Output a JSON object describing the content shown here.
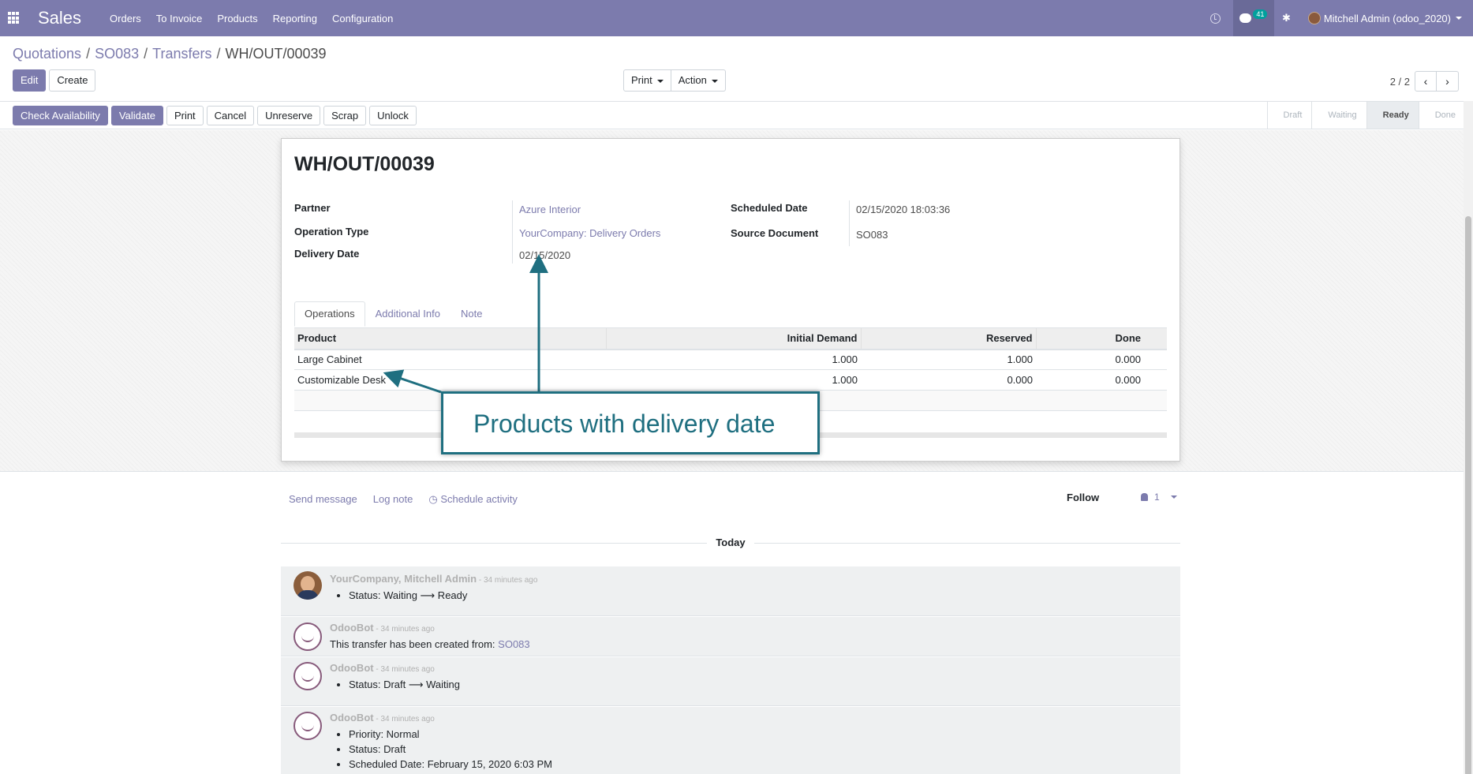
{
  "nav": {
    "brand": "Sales",
    "menu": [
      "Orders",
      "To Invoice",
      "Products",
      "Reporting",
      "Configuration"
    ],
    "chat_count": "41",
    "user": "Mitchell Admin (odoo_2020)"
  },
  "breadcrumb": {
    "items": [
      "Quotations",
      "SO083",
      "Transfers"
    ],
    "current": "WH/OUT/00039"
  },
  "control_panel": {
    "edit": "Edit",
    "create": "Create",
    "print": "Print",
    "action": "Action",
    "pager": "2 / 2"
  },
  "statusbar": {
    "buttons": [
      "Check Availability",
      "Validate",
      "Print",
      "Cancel",
      "Unreserve",
      "Scrap",
      "Unlock"
    ],
    "stages": [
      "Draft",
      "Waiting",
      "Ready",
      "Done"
    ],
    "active_stage": "Ready"
  },
  "record": {
    "title": "WH/OUT/00039",
    "partner_label": "Partner",
    "partner": "Azure Interior",
    "operation_type_label": "Operation Type",
    "operation_type": "YourCompany: Delivery Orders",
    "delivery_date_label": "Delivery Date",
    "delivery_date": "02/15/2020",
    "scheduled_date_label": "Scheduled Date",
    "scheduled_date": "02/15/2020 18:03:36",
    "source_document_label": "Source Document",
    "source_document": "SO083"
  },
  "tabs": [
    "Operations",
    "Additional Info",
    "Note"
  ],
  "operations": {
    "columns": [
      "Product",
      "Initial Demand",
      "Reserved",
      "Done"
    ],
    "rows": [
      {
        "product": "Large Cabinet",
        "initial": "1.000",
        "reserved": "1.000",
        "done": "0.000"
      },
      {
        "product": "Customizable Desk",
        "initial": "1.000",
        "reserved": "0.000",
        "done": "0.000"
      }
    ]
  },
  "annotation": {
    "text": "Products with delivery date",
    "color": "#1f6f80"
  },
  "chatter": {
    "send_message": "Send message",
    "log_note": "Log note",
    "schedule_activity": "Schedule activity",
    "follow": "Follow",
    "followers": "1",
    "today": "Today",
    "messages": [
      {
        "author": "YourCompany, Mitchell Admin",
        "date": " - 34 minutes ago",
        "items": [
          "Status: Waiting ⟶ Ready"
        ]
      },
      {
        "author": "OdooBot",
        "date": " - 34 minutes ago",
        "body": "This transfer has been created from: ",
        "link": "SO083"
      },
      {
        "author": "OdooBot",
        "date": " - 34 minutes ago",
        "items": [
          "Status: Draft ⟶ Waiting"
        ]
      },
      {
        "author": "OdooBot",
        "date": " - 34 minutes ago",
        "items": [
          "Priority: Normal",
          "Status: Draft",
          "Scheduled Date: February 15, 2020 6:03 PM"
        ]
      }
    ]
  },
  "colors": {
    "brand": "#7c7bad",
    "primary_button": "#7c7bad"
  }
}
